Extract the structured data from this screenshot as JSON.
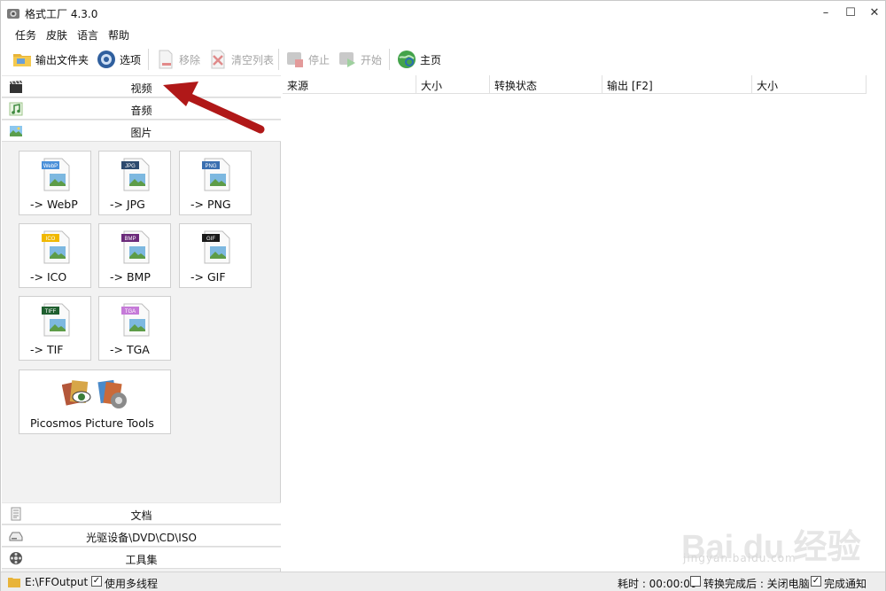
{
  "window": {
    "title": "格式工厂 4.3.0",
    "min_icon": "minimize-icon",
    "max_icon": "maximize-icon",
    "close_icon": "close-icon"
  },
  "menu": [
    "任务",
    "皮肤",
    "语言",
    "帮助"
  ],
  "toolbar": {
    "output_folder": "输出文件夹",
    "options": "选项",
    "remove": "移除",
    "clear_list": "清空列表",
    "stop": "停止",
    "start": "开始",
    "home": "主页"
  },
  "categories": {
    "video": "视频",
    "audio": "音频",
    "image": "图片",
    "document": "文档",
    "optical": "光驱设备\\DVD\\CD\\ISO",
    "tools": "工具集"
  },
  "image_tools": [
    {
      "label": "-> WebP",
      "badge": "WebP",
      "badge_color": "#4a90d9"
    },
    {
      "label": "-> JPG",
      "badge": "JPG",
      "badge_color": "#2d4a6e"
    },
    {
      "label": "-> PNG",
      "badge": "PNG",
      "badge_color": "#3a6fb0"
    },
    {
      "label": "-> ICO",
      "badge": "ICO",
      "badge_color": "#f0b800"
    },
    {
      "label": "-> BMP",
      "badge": "BMP",
      "badge_color": "#6b2a7a"
    },
    {
      "label": "-> GIF",
      "badge": "GIF",
      "badge_color": "#1a1a1a"
    },
    {
      "label": "-> TIF",
      "badge": "TIFF",
      "badge_color": "#1f5f2f"
    },
    {
      "label": "-> TGA",
      "badge": "TGA",
      "badge_color": "#c57ad8"
    }
  ],
  "picosmos": {
    "label": "Picosmos Picture Tools"
  },
  "columns": [
    "来源",
    "大小",
    "转换状态",
    "输出 [F2]",
    "大小"
  ],
  "status": {
    "output_path": "E:\\FFOutput",
    "multithread": "使用多线程",
    "elapsed": "耗时 : 00:00:00",
    "after_convert": "转换完成后 : 关闭电脑",
    "notify": "完成通知"
  },
  "watermark": {
    "logo": "Bai du 经验",
    "sub": "jingyan.baidu.com"
  },
  "colors": {
    "annotation_arrow": "#b01818",
    "accent": "#3a78c8"
  }
}
